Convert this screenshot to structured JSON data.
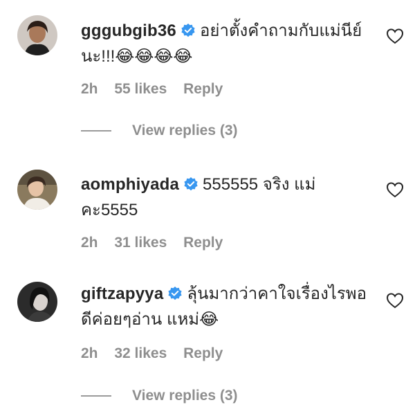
{
  "comments": [
    {
      "username": "gggubgib36",
      "text": "อย่าตั้งคำถามกับแม่นีย์นะ!!!😂😂😂😂",
      "time": "2h",
      "likes": "55 likes",
      "reply": "Reply",
      "view_replies": "View replies (3)"
    },
    {
      "username": "aomphiyada",
      "text": "555555 จริง แม่คะ5555",
      "time": "2h",
      "likes": "31 likes",
      "reply": "Reply"
    },
    {
      "username": "giftzapyya",
      "text": "ลุ้นมากว่าคาใจเรื่องไรพอดีค่อยๆอ่าน แหม่😂",
      "time": "2h",
      "likes": "32 likes",
      "reply": "Reply",
      "view_replies": "View replies (3)"
    }
  ],
  "colors": {
    "text": "#262626",
    "muted": "#8e8e8e",
    "verified": "#3897f0"
  },
  "icons": {
    "verified": "verified-badge-icon",
    "like": "heart-outline-icon"
  }
}
